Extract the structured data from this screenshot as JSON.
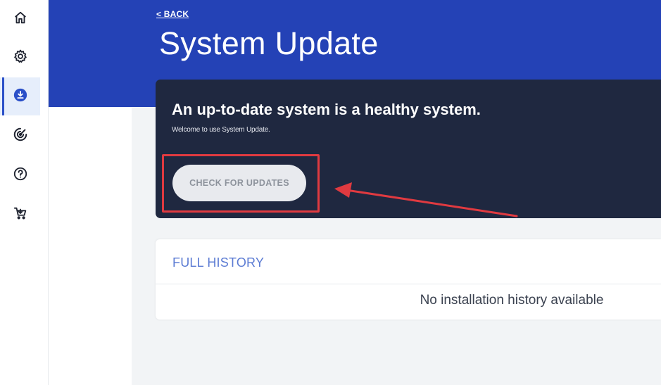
{
  "sidebar": {
    "items": [
      {
        "icon": "home-icon",
        "label": "Home"
      },
      {
        "icon": "gear-icon",
        "label": "Settings"
      },
      {
        "icon": "download-icon",
        "label": "System Update",
        "active": true
      },
      {
        "icon": "radar-icon",
        "label": "Scan"
      },
      {
        "icon": "help-icon",
        "label": "Help"
      },
      {
        "icon": "cart-icon",
        "label": "Shop"
      }
    ]
  },
  "header": {
    "back_label": "< BACK",
    "title": "System Update"
  },
  "hero": {
    "heading": "An up-to-date system is a healthy system.",
    "subtitle": "Welcome to use System Update.",
    "button_label": "CHECK FOR UPDATES"
  },
  "history": {
    "title": "FULL HISTORY",
    "empty_message": "No installation history available"
  },
  "colors": {
    "banner": "#2442b6",
    "hero_card": "#1f2840",
    "accent": "#2b50c8",
    "annotation": "#e03a40"
  }
}
